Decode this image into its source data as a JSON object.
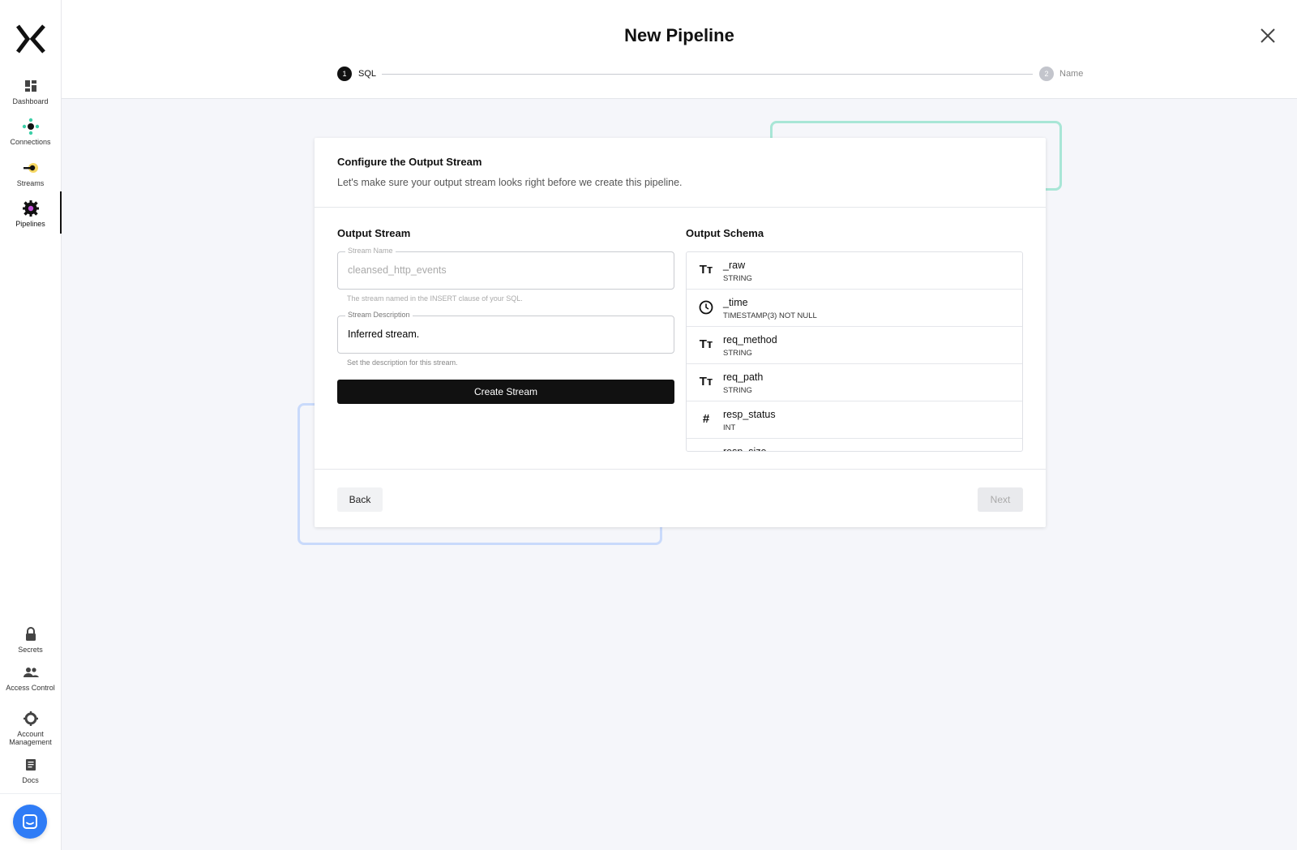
{
  "header": {
    "title": "New Pipeline",
    "steps": [
      {
        "number": "1",
        "label": "SQL"
      },
      {
        "number": "2",
        "label": "Name"
      }
    ]
  },
  "sidebar": {
    "top_items": [
      {
        "label": "Dashboard",
        "icon": "dashboard-icon"
      },
      {
        "label": "Connections",
        "icon": "connections-icon"
      },
      {
        "label": "Streams",
        "icon": "streams-icon"
      },
      {
        "label": "Pipelines",
        "icon": "pipelines-icon"
      }
    ],
    "bottom_items": [
      {
        "label": "Secrets",
        "icon": "lock-icon"
      },
      {
        "label": "Access Control",
        "icon": "people-icon"
      },
      {
        "label": "Account Management",
        "icon": "gear-icon"
      },
      {
        "label": "Docs",
        "icon": "document-icon"
      }
    ]
  },
  "card": {
    "title": "Configure the Output Stream",
    "subtitle": "Let's make sure your output stream looks right before we create this pipeline.",
    "output_stream": {
      "heading": "Output Stream",
      "name_label": "Stream Name",
      "name_value": "cleansed_http_events",
      "name_helper": "The stream named in the INSERT clause of your SQL.",
      "desc_label": "Stream Description",
      "desc_value": "Inferred stream.",
      "desc_helper": "Set the description for this stream.",
      "create_label": "Create Stream"
    },
    "output_schema": {
      "heading": "Output Schema",
      "fields": [
        {
          "name": "_raw",
          "type": "STRING",
          "icon": "text-type-icon"
        },
        {
          "name": "_time",
          "type": "TIMESTAMP(3) NOT NULL",
          "icon": "clock-icon"
        },
        {
          "name": "req_method",
          "type": "STRING",
          "icon": "text-type-icon"
        },
        {
          "name": "req_path",
          "type": "STRING",
          "icon": "text-type-icon"
        },
        {
          "name": "resp_status",
          "type": "INT",
          "icon": "hash-icon"
        },
        {
          "name": "resp_size",
          "type": "",
          "icon": "hash-icon"
        }
      ]
    },
    "back_label": "Back",
    "next_label": "Next"
  },
  "colors": {
    "accent": "#111111",
    "chat": "#2f7cf6",
    "deco_teal": "#a8e6d6",
    "deco_blue": "#c9dafb"
  }
}
